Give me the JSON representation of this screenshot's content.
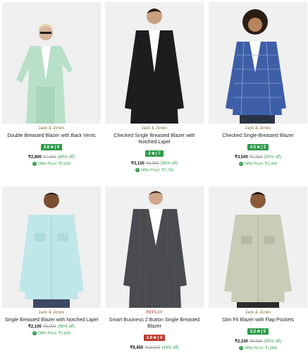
{
  "products": [
    {
      "brand": "Jack & Jones",
      "name": "Double Breasted Blazer with Back Vents",
      "rating": "3.8",
      "reviews": "9",
      "rating_color": "#2e9a4a",
      "price": "₹2,800",
      "mrp": "₹7,000",
      "discount": "(60% off)",
      "offer": "Offer Price: ₹2,600"
    },
    {
      "brand": "Jack & Jones",
      "name": "Checked Single Breasted Blazer with Notched Lapel",
      "rating": "3",
      "reviews": "7",
      "rating_color": "#2e9a4a",
      "price": "₹3,150",
      "mrp": "₹6,999",
      "discount": "(55% off)",
      "offer": "Offer Price: ₹2,709"
    },
    {
      "brand": "Jack & Jones",
      "name": "Checked Single-Breasted Blazer",
      "rating": "4.5",
      "reviews": "2",
      "rating_color": "#2e9a4a",
      "price": "₹3,500",
      "mrp": "₹7,000",
      "discount": "(50% off)",
      "offer": "Offer Price: ₹3,300"
    },
    {
      "brand": "Jack & Jones",
      "name": "Single Breasted Blazer with Notched Lapel",
      "rating": "",
      "reviews": "",
      "rating_color": "",
      "price": "₹2,100",
      "mrp": "₹5,999",
      "discount": "(65% off)",
      "offer": "Offer Price: ₹1,806"
    },
    {
      "brand": "REPLAY",
      "name": "Smart Business 2 Button Single Breasted Blazer",
      "rating": "2.8",
      "reviews": "4",
      "rating_color": "#c0392b",
      "price": "₹9,450",
      "mrp": "₹16,500",
      "discount": "(43% off)",
      "offer": ""
    },
    {
      "brand": "Jack & Jones",
      "name": "Slim Fit Blazer with Flap Pockets",
      "rating": "3.2",
      "reviews": "5",
      "rating_color": "#2e9a4a",
      "price": "₹2,100",
      "mrp": "₹5,999",
      "discount": "(65% off)",
      "offer": "Offer Price: ₹1,806"
    }
  ],
  "colors": {
    "accent_green": "#2e9a4a",
    "brand_gold": "#8a6d3b",
    "low_rating_red": "#c0392b"
  }
}
